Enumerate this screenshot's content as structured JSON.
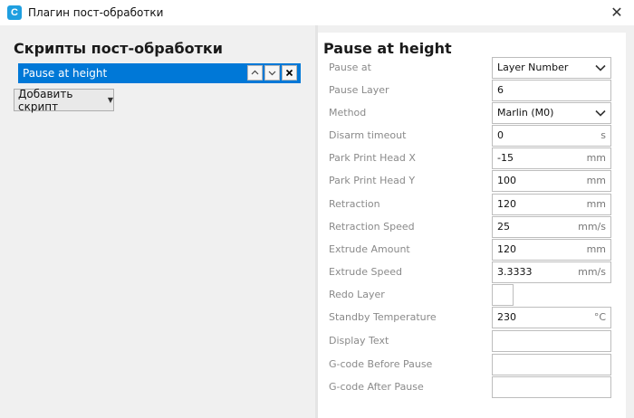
{
  "window": {
    "title": "Плагин пост-обработки",
    "icon": "cura-logo-icon"
  },
  "left": {
    "heading": "Скрипты пост-обработки",
    "scripts": [
      {
        "label": "Pause at height"
      }
    ],
    "add_button_label": "Добавить скрипт"
  },
  "settings": {
    "heading": "Pause at height",
    "rows": [
      {
        "label": "Pause at",
        "type": "select",
        "value": "Layer Number"
      },
      {
        "label": "Pause Layer",
        "type": "text",
        "value": "6"
      },
      {
        "label": "Method",
        "type": "select",
        "value": "Marlin (M0)"
      },
      {
        "label": "Disarm timeout",
        "type": "text",
        "value": "0",
        "unit": "s"
      },
      {
        "label": "Park Print Head X",
        "type": "text",
        "value": "-15",
        "unit": "mm"
      },
      {
        "label": "Park Print Head Y",
        "type": "text",
        "value": "100",
        "unit": "mm"
      },
      {
        "label": "Retraction",
        "type": "text",
        "value": "120",
        "unit": "mm"
      },
      {
        "label": "Retraction Speed",
        "type": "text",
        "value": "25",
        "unit": "mm/s"
      },
      {
        "label": "Extrude Amount",
        "type": "text",
        "value": "120",
        "unit": "mm"
      },
      {
        "label": "Extrude Speed",
        "type": "text",
        "value": "3.3333",
        "unit": "mm/s"
      },
      {
        "label": "Redo Layer",
        "type": "checkbox",
        "checked": false
      },
      {
        "label": "Standby Temperature",
        "type": "text",
        "value": "230",
        "unit": "°C"
      },
      {
        "label": "Display Text",
        "type": "text",
        "value": ""
      },
      {
        "label": "G-code Before Pause",
        "type": "text",
        "value": ""
      },
      {
        "label": "G-code After Pause",
        "type": "text",
        "value": ""
      }
    ]
  },
  "colors": {
    "selection": "#0078d7",
    "label": "#8a8a8a"
  }
}
